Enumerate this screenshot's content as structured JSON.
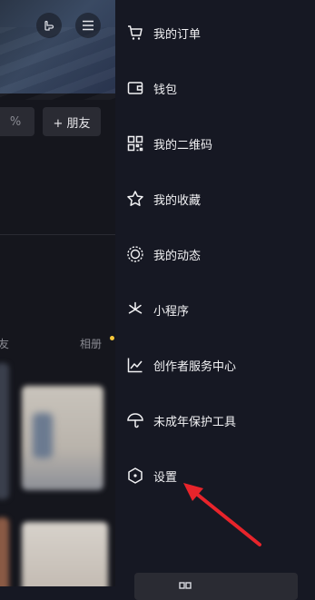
{
  "background": {
    "add_friend_label": "+ 朋友",
    "left_partial_text": "%",
    "tab_left_partial": "字友",
    "tab_right_partial": "相册"
  },
  "drawer": {
    "items": [
      {
        "label": "我的订单",
        "icon": "cart-icon"
      },
      {
        "label": "钱包",
        "icon": "wallet-icon"
      },
      {
        "label": "我的二维码",
        "icon": "qrcode-icon"
      },
      {
        "label": "我的收藏",
        "icon": "star-icon"
      },
      {
        "label": "我的动态",
        "icon": "activity-icon"
      },
      {
        "label": "小程序",
        "icon": "mini-program-icon"
      },
      {
        "label": "创作者服务中心",
        "icon": "chart-icon"
      },
      {
        "label": "未成年保护工具",
        "icon": "umbrella-icon"
      },
      {
        "label": "设置",
        "icon": "settings-hexagon-icon"
      }
    ]
  },
  "colors": {
    "background": "#161823",
    "text": "#f2f2f4",
    "annotation_arrow": "#e8242b",
    "badge_dot": "#f7c73a"
  }
}
